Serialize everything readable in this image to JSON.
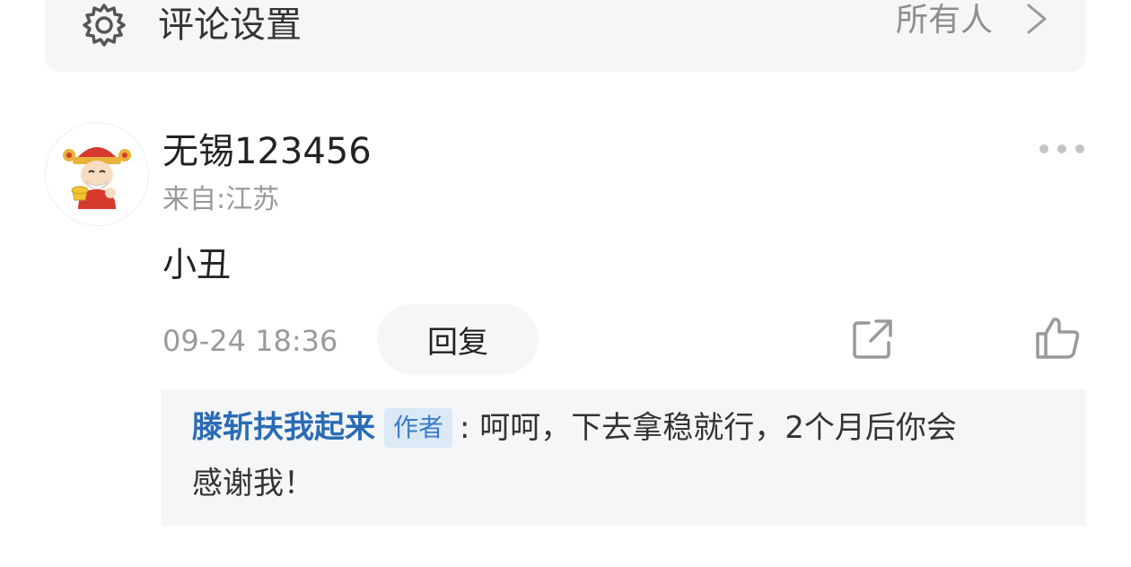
{
  "settings": {
    "label": "评论设置",
    "value": "所有人",
    "icon": "gear-icon",
    "chevron_icon": "chevron-right-icon"
  },
  "comment": {
    "username": "无锡123456",
    "origin": "来自:江苏",
    "text": "小丑",
    "timestamp": "09-24 18:36",
    "reply_label": "回复",
    "avatar_icon": "god-of-wealth-avatar",
    "more_icon": "more-dots-icon",
    "share_icon": "share-icon",
    "like_icon": "thumbs-up-icon"
  },
  "reply": {
    "author": "滕斩扶我起来",
    "badge": "作者",
    "text_line1": ": 呵呵，下去拿稳就行，2个月后你会",
    "text_line2": "感谢我！"
  },
  "colors": {
    "author_blue": "#2a6bb5",
    "badge_bg": "#dbe9f6",
    "panel_bg": "#f5f6f7",
    "muted_text": "#999999"
  }
}
